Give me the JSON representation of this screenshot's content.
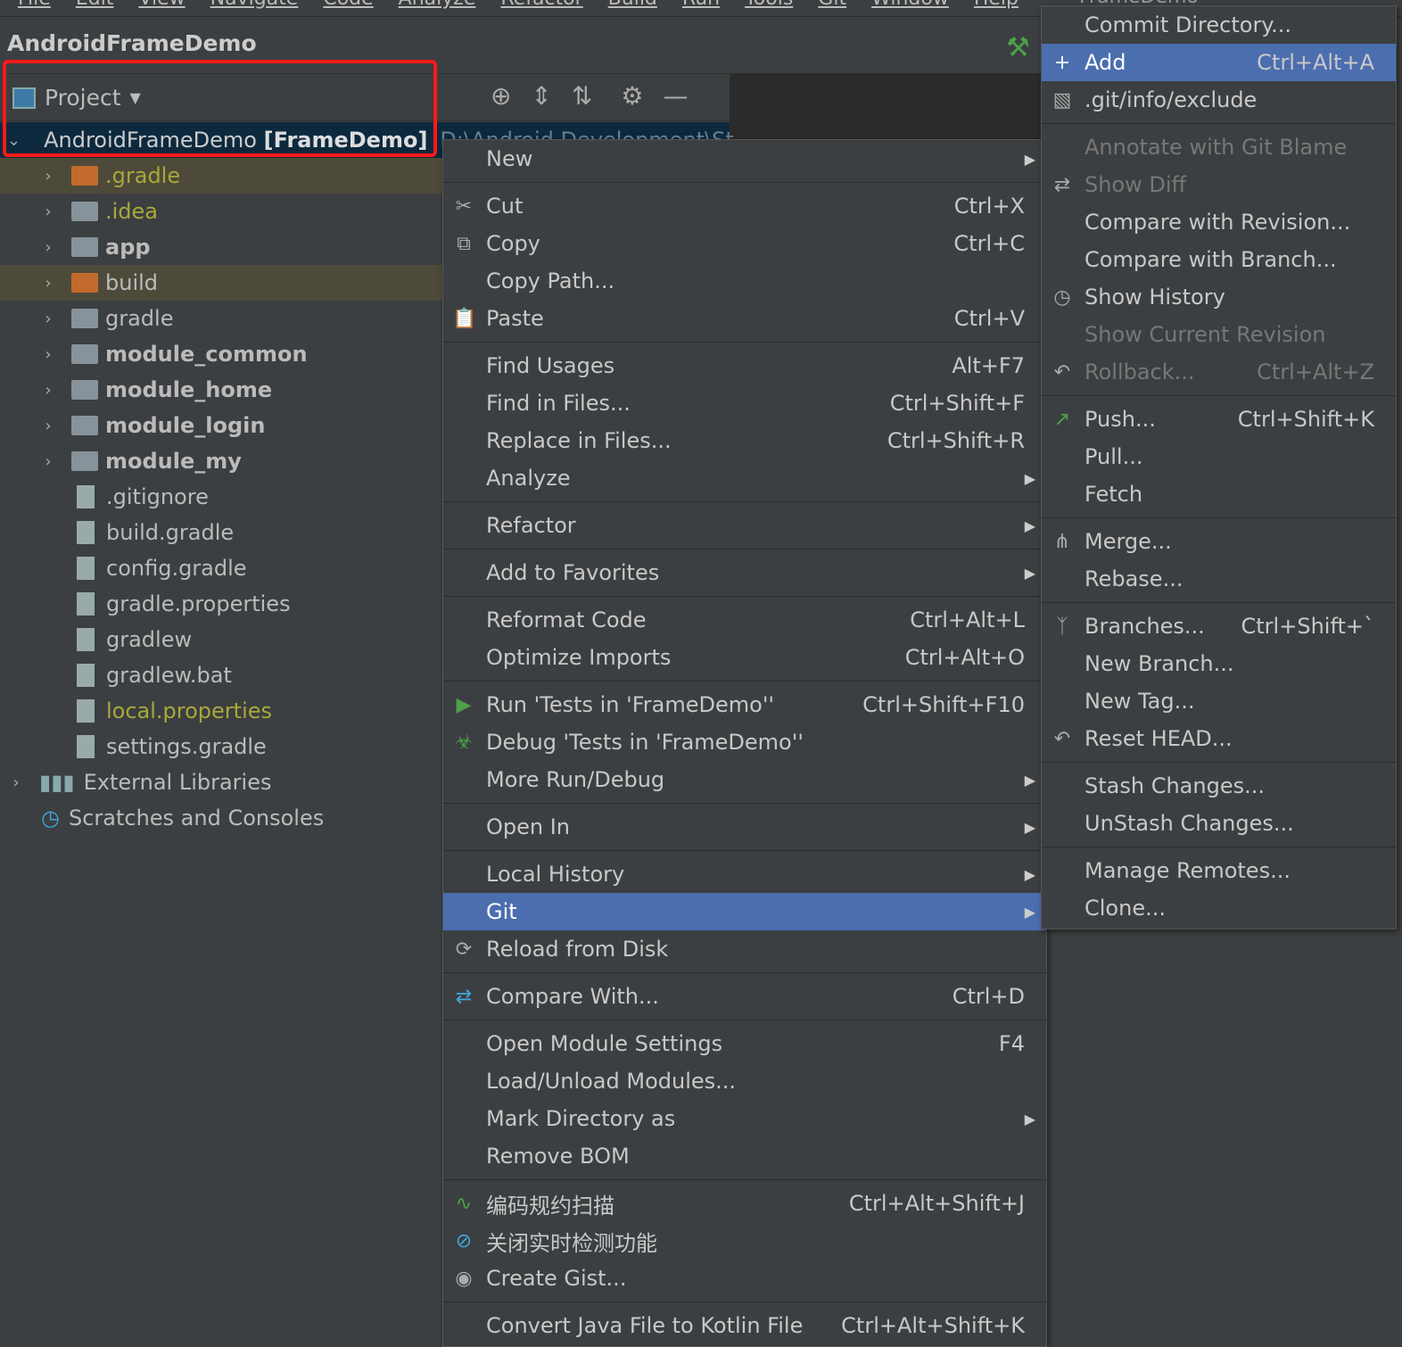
{
  "menubar": [
    "File",
    "Edit",
    "View",
    "Navigate",
    "Code",
    "Analyze",
    "Refactor",
    "Build",
    "Run",
    "Tools",
    "Git",
    "Window",
    "Help"
  ],
  "window_title": "FrameDemo",
  "project_title": "AndroidFrameDemo",
  "toolbar": {
    "view_label": "Project"
  },
  "tree": {
    "root": {
      "name": "AndroidFrameDemo",
      "module": "[FrameDemo]",
      "path": "D:\\Android Development\\St"
    },
    "items": [
      {
        "label": ".gradle",
        "kind": "folder-orange",
        "style": "yellow",
        "expand": true,
        "hl": true
      },
      {
        "label": ".idea",
        "kind": "folder",
        "style": "yellow",
        "expand": true
      },
      {
        "label": "app",
        "kind": "module",
        "style": "bold",
        "expand": true
      },
      {
        "label": "build",
        "kind": "folder-orange",
        "style": "",
        "expand": true,
        "hl": true
      },
      {
        "label": "gradle",
        "kind": "folder",
        "style": "",
        "expand": true
      },
      {
        "label": "module_common",
        "kind": "module",
        "style": "bold",
        "expand": true
      },
      {
        "label": "module_home",
        "kind": "module",
        "style": "bold",
        "expand": true
      },
      {
        "label": "module_login",
        "kind": "module",
        "style": "bold",
        "expand": true
      },
      {
        "label": "module_my",
        "kind": "module",
        "style": "bold",
        "expand": true
      },
      {
        "label": ".gitignore",
        "kind": "file",
        "style": ""
      },
      {
        "label": "build.gradle",
        "kind": "file",
        "style": ""
      },
      {
        "label": "config.gradle",
        "kind": "file",
        "style": ""
      },
      {
        "label": "gradle.properties",
        "kind": "file",
        "style": ""
      },
      {
        "label": "gradlew",
        "kind": "file",
        "style": ""
      },
      {
        "label": "gradlew.bat",
        "kind": "file",
        "style": ""
      },
      {
        "label": "local.properties",
        "kind": "file",
        "style": "yellow"
      },
      {
        "label": "settings.gradle",
        "kind": "file",
        "style": ""
      }
    ],
    "external": "External Libraries",
    "scratches": "Scratches and Consoles"
  },
  "context_menu": [
    {
      "label": "New",
      "sub": true
    },
    "sep",
    {
      "label": "Cut",
      "shortcut": "Ctrl+X",
      "icon": "scissors-icon"
    },
    {
      "label": "Copy",
      "shortcut": "Ctrl+C",
      "icon": "copy-icon"
    },
    {
      "label": "Copy Path..."
    },
    {
      "label": "Paste",
      "shortcut": "Ctrl+V",
      "icon": "paste-icon"
    },
    "sep",
    {
      "label": "Find Usages",
      "shortcut": "Alt+F7"
    },
    {
      "label": "Find in Files...",
      "shortcut": "Ctrl+Shift+F"
    },
    {
      "label": "Replace in Files...",
      "shortcut": "Ctrl+Shift+R"
    },
    {
      "label": "Analyze",
      "sub": true
    },
    "sep",
    {
      "label": "Refactor",
      "sub": true
    },
    "sep",
    {
      "label": "Add to Favorites",
      "sub": true
    },
    "sep",
    {
      "label": "Reformat Code",
      "shortcut": "Ctrl+Alt+L"
    },
    {
      "label": "Optimize Imports",
      "shortcut": "Ctrl+Alt+O"
    },
    "sep",
    {
      "label": "Run 'Tests in 'FrameDemo''",
      "shortcut": "Ctrl+Shift+F10",
      "icon": "run-icon"
    },
    {
      "label": "Debug 'Tests in 'FrameDemo''",
      "icon": "debug-icon"
    },
    {
      "label": "More Run/Debug",
      "sub": true
    },
    "sep",
    {
      "label": "Open In",
      "sub": true
    },
    "sep",
    {
      "label": "Local History",
      "sub": true
    },
    {
      "label": "Git",
      "sub": true,
      "active": true
    },
    {
      "label": "Reload from Disk",
      "icon": "reload-icon"
    },
    "sep",
    {
      "label": "Compare With...",
      "shortcut": "Ctrl+D",
      "icon": "compare-icon"
    },
    "sep",
    {
      "label": "Open Module Settings",
      "shortcut": "F4"
    },
    {
      "label": "Load/Unload Modules..."
    },
    {
      "label": "Mark Directory as",
      "sub": true
    },
    {
      "label": "Remove BOM"
    },
    "sep",
    {
      "label": "编码规约扫描",
      "shortcut": "Ctrl+Alt+Shift+J",
      "icon": "scan-icon"
    },
    {
      "label": "关闭实时检测功能",
      "icon": "disable-icon"
    },
    {
      "label": "Create Gist...",
      "icon": "github-icon"
    },
    "sep",
    {
      "label": "Convert Java File to Kotlin File",
      "shortcut": "Ctrl+Alt+Shift+K"
    }
  ],
  "git_menu": [
    {
      "label": "Commit Directory..."
    },
    {
      "label": "Add",
      "shortcut": "Ctrl+Alt+A",
      "icon": "plus-icon",
      "active": true
    },
    {
      "label": ".git/info/exclude",
      "icon": "ignore-file-icon"
    },
    "sep",
    {
      "label": "Annotate with Git Blame",
      "disabled": true
    },
    {
      "label": "Show Diff",
      "disabled": true,
      "icon": "diff-icon"
    },
    {
      "label": "Compare with Revision..."
    },
    {
      "label": "Compare with Branch..."
    },
    {
      "label": "Show History",
      "icon": "history-icon"
    },
    {
      "label": "Show Current Revision",
      "disabled": true
    },
    {
      "label": "Rollback...",
      "shortcut": "Ctrl+Alt+Z",
      "disabled": true,
      "icon": "rollback-icon"
    },
    "sep",
    {
      "label": "Push...",
      "shortcut": "Ctrl+Shift+K",
      "icon": "push-icon"
    },
    {
      "label": "Pull..."
    },
    {
      "label": "Fetch"
    },
    "sep",
    {
      "label": "Merge...",
      "icon": "merge-icon"
    },
    {
      "label": "Rebase..."
    },
    "sep",
    {
      "label": "Branches...",
      "shortcut": "Ctrl+Shift+`",
      "icon": "branch-icon"
    },
    {
      "label": "New Branch..."
    },
    {
      "label": "New Tag..."
    },
    {
      "label": "Reset HEAD...",
      "icon": "reset-icon"
    },
    "sep",
    {
      "label": "Stash Changes..."
    },
    {
      "label": "UnStash Changes..."
    },
    "sep",
    {
      "label": "Manage Remotes..."
    },
    {
      "label": "Clone..."
    }
  ]
}
